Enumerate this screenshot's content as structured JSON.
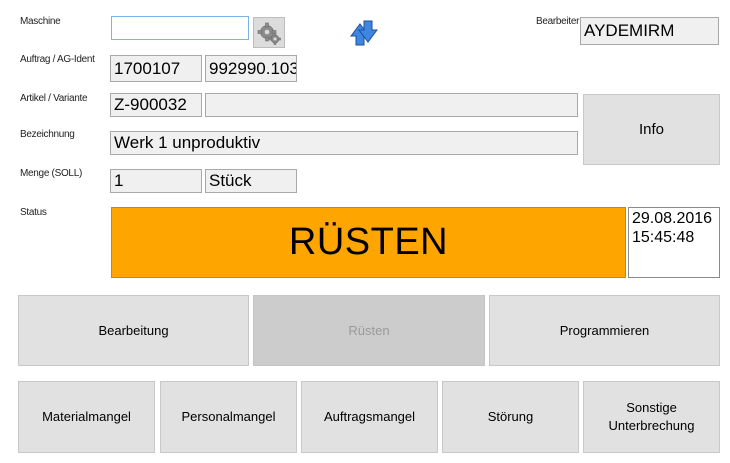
{
  "labels": {
    "maschine": "Maschine",
    "auftrag": "Auftrag / AG-Ident",
    "artikel": "Artikel / Variante",
    "bezeichnung": "Bezeichnung",
    "menge": "Menge (SOLL)",
    "status": "Status",
    "bearbeiter": "Bearbeiter"
  },
  "fields": {
    "maschine": "",
    "auftrag": "1700107",
    "ag_ident": "992990.103",
    "artikel": "Z-900032",
    "variante": "",
    "bezeichnung": "Werk 1 unproduktiv",
    "menge": "1",
    "einheit": "Stück",
    "bearbeiter": "AYDEMIRM"
  },
  "status": {
    "text": "RÜSTEN",
    "date": "29.08.2016",
    "time": "15:45:48",
    "color": "#ffa500"
  },
  "icons": {
    "settings": "gear-icon",
    "refresh": "refresh-arrows-icon"
  },
  "buttons": {
    "info": "Info",
    "bearbeitung": "Bearbeitung",
    "ruesten": "Rüsten",
    "programmieren": "Programmieren",
    "materialmangel": "Materialmangel",
    "personalmangel": "Personalmangel",
    "auftragsmangel": "Auftragsmangel",
    "stoerung": "Störung",
    "sonstige_line1": "Sonstige",
    "sonstige_line2": "Unterbrechung"
  }
}
